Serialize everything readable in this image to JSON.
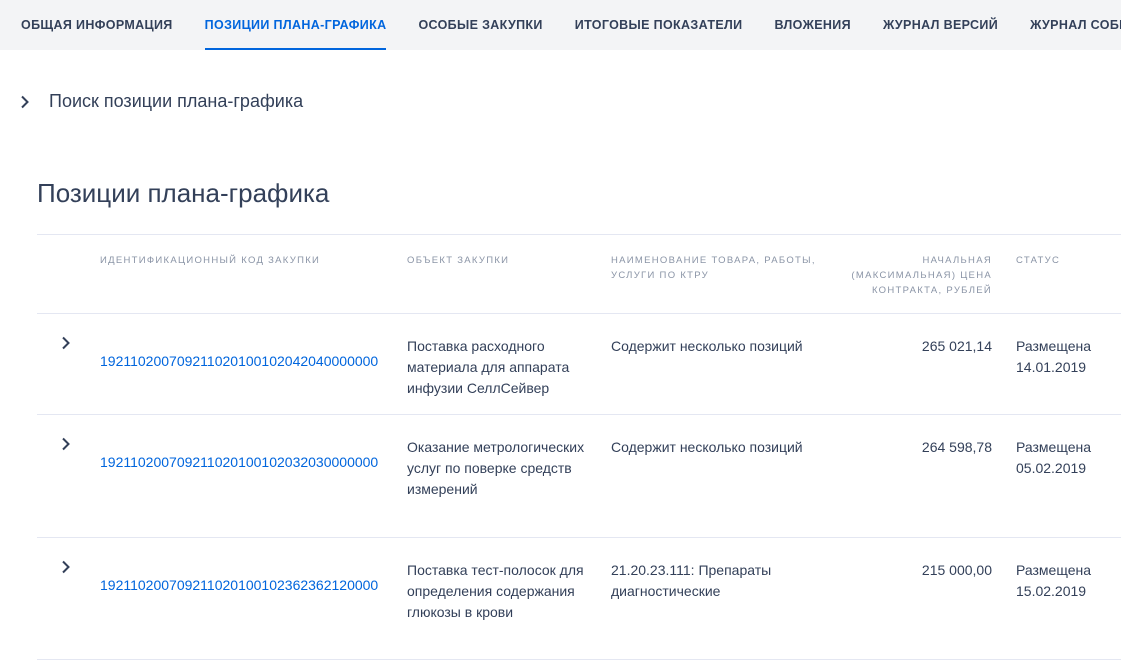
{
  "tabs": [
    {
      "label": "ОБЩАЯ ИНФОРМАЦИЯ",
      "active": false
    },
    {
      "label": "ПОЗИЦИИ ПЛАНА-ГРАФИКА",
      "active": true
    },
    {
      "label": "ОСОБЫЕ ЗАКУПКИ",
      "active": false
    },
    {
      "label": "ИТОГОВЫЕ ПОКАЗАТЕЛИ",
      "active": false
    },
    {
      "label": "ВЛОЖЕНИЯ",
      "active": false
    },
    {
      "label": "ЖУРНАЛ ВЕРСИЙ",
      "active": false
    },
    {
      "label": "ЖУРНАЛ СОБЫТИЙ",
      "active": false
    }
  ],
  "search": {
    "label": "Поиск позиции плана-графика",
    "icon": "chevron-right-icon"
  },
  "section": {
    "title": "Позиции плана-графика"
  },
  "table": {
    "headers": {
      "code": "ИДЕНТИФИКАЦИОННЫЙ КОД ЗАКУПКИ",
      "object": "ОБЪЕКТ ЗАКУПКИ",
      "name": "НАИМЕНОВАНИЕ ТОВАРА, РАБОТЫ, УСЛУГИ ПО КТРУ",
      "price": "НАЧАЛЬНАЯ (МАКСИМАЛЬНАЯ) ЦЕНА КОНТРАКТА, РУБЛЕЙ",
      "status": "СТАТУС"
    },
    "rows": [
      {
        "code": "192110200709211020100102042040000000",
        "object": "Поставка расходного материала для аппарата инфузии СеллСейвер",
        "name": "Содержит несколько позиций",
        "price": "265 021,14",
        "status": "Размещена 14.01.2019"
      },
      {
        "code": "192110200709211020100102032030000000",
        "object": "Оказание метрологических услуг по поверке средств измерений",
        "name": "Содержит несколько позиций",
        "price": "264 598,78",
        "status": "Размещена 05.02.2019"
      },
      {
        "code": "192110200709211020100102362362120000",
        "object": "Поставка тест-полосок для определения содержания глюкозы в крови",
        "name": "21.20.23.111: Препараты диагностические",
        "price": "215 000,00",
        "status": "Размещена 15.02.2019"
      }
    ]
  },
  "colors": {
    "accent": "#0065dd",
    "text": "#334059",
    "muted": "#8a94a6",
    "tabbar_bg": "#f3f4f6",
    "divider": "#e4e7f2"
  }
}
